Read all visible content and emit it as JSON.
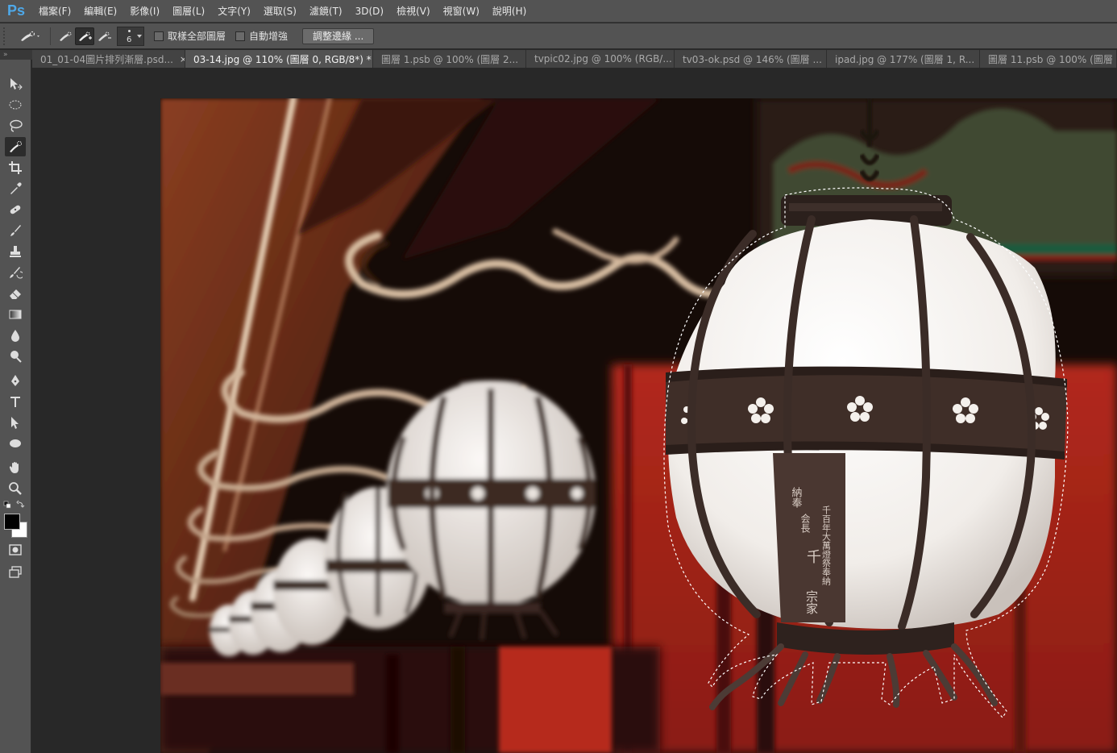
{
  "app": {
    "logo": "Ps"
  },
  "menu": [
    "檔案(F)",
    "編輯(E)",
    "影像(I)",
    "圖層(L)",
    "文字(Y)",
    "選取(S)",
    "濾鏡(T)",
    "3D(D)",
    "檢視(V)",
    "視窗(W)",
    "說明(H)"
  ],
  "options": {
    "brush_size": "6",
    "sample_all_layers": "取樣全部圖層",
    "auto_enhance": "自動增強",
    "refine_edge": "調整邊緣 ..."
  },
  "tabs": [
    {
      "label": "01_01-04圖片排列漸層.psd...",
      "active": false
    },
    {
      "label": "03-14.jpg @ 110% (圖層 0, RGB/8*) *",
      "active": true
    },
    {
      "label": "圖層 1.psb @ 100% (圖層 2...",
      "active": false
    },
    {
      "label": "tvpic02.jpg @ 100% (RGB/...",
      "active": false
    },
    {
      "label": "tv03-ok.psd @ 146% (圖層 ...",
      "active": false
    },
    {
      "label": "ipad.jpg @ 177% (圖層 1, R...",
      "active": false
    },
    {
      "label": "圖層 11.psb @ 100% (圖層 ...",
      "active": false
    }
  ],
  "tab_close_glyph": "×",
  "collapse_glyph": "»",
  "tools": [
    "move-icon",
    "elliptical-marquee-icon",
    "lasso-icon",
    "quick-selection-icon",
    "crop-icon",
    "eyedropper-icon",
    "healing-brush-icon",
    "brush-icon",
    "clone-stamp-icon",
    "history-brush-icon",
    "eraser-icon",
    "gradient-icon",
    "blur-icon",
    "dodge-icon",
    "pen-icon",
    "type-icon",
    "path-selection-icon",
    "ellipse-shape-icon",
    "hand-icon",
    "zoom-icon"
  ],
  "colors": {
    "foreground": "#000000",
    "background": "#ffffff",
    "accent": "#4ea8e8"
  },
  "canvas": {
    "description_glyphs": {
      "plaque_col1": "納奉",
      "plaque_col2": "会長",
      "plaque_col3": "千百年大萬燈祭奉納",
      "plaque_col4": "千",
      "plaque_col5": "宗家"
    }
  }
}
